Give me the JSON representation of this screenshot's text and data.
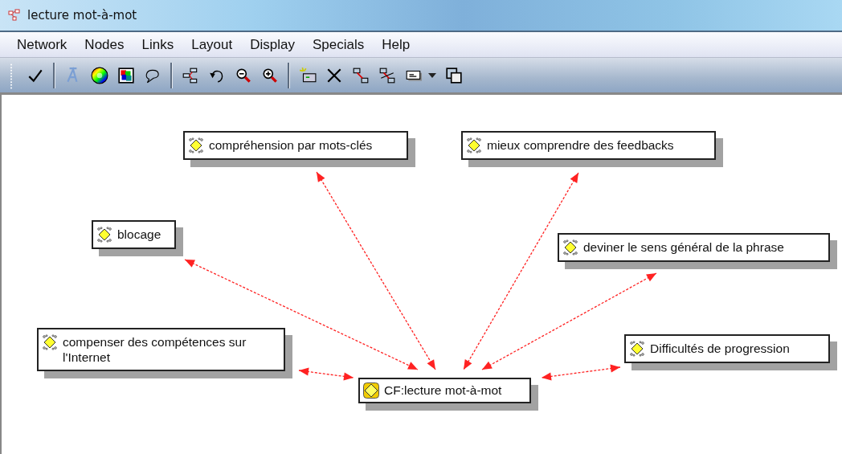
{
  "window": {
    "title": "lecture mot-à-mot"
  },
  "menu": [
    "Network",
    "Nodes",
    "Links",
    "Layout",
    "Display",
    "Specials",
    "Help"
  ],
  "nodes": [
    {
      "label": "compréhension par mots-clés",
      "kind": "concept",
      "linked": true
    },
    {
      "label": "mieux comprendre des feedbacks",
      "kind": "concept",
      "linked": true
    },
    {
      "label": "blocage",
      "kind": "concept",
      "linked": true
    },
    {
      "label": "deviner le sens général de la phrase",
      "kind": "concept",
      "linked": true
    },
    {
      "label": "compenser des compétences sur l'Internet",
      "kind": "concept",
      "linked": true
    },
    {
      "label": "Difficultés de progression",
      "kind": "concept",
      "linked": true
    },
    {
      "label": "CF:lecture mot-à-mot",
      "kind": "core"
    }
  ]
}
